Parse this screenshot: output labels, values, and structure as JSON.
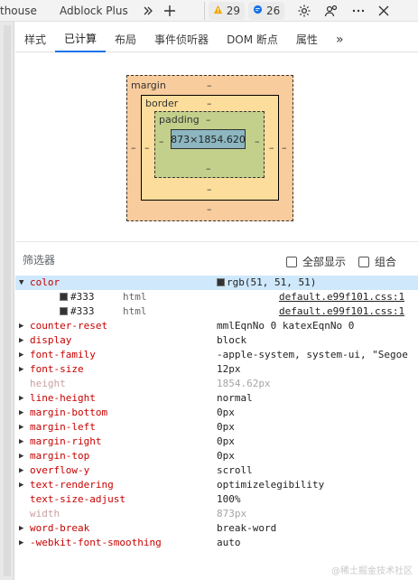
{
  "toolbar": {
    "tabs": [
      "thouse",
      "Adblock Plus"
    ],
    "more_icon": "chevrons-right-icon",
    "add_icon": "plus-icon",
    "warnings": "29",
    "messages": "26",
    "settings_icon": "gear-icon",
    "feedback_icon": "people-icon",
    "more_menu_icon": "ellipsis-icon",
    "close_icon": "close-icon"
  },
  "subtabs": [
    "样式",
    "已计算",
    "布局",
    "事件侦听器",
    "DOM 断点",
    "属性"
  ],
  "subtabs_more": "»",
  "boxmodel": {
    "margin_label": "margin",
    "border_label": "border",
    "padding_label": "padding",
    "content": "873×1854.620",
    "dash": "–"
  },
  "filter": {
    "label": "筛选器",
    "show_all": "全部显示",
    "group": "组合"
  },
  "properties": [
    {
      "name": "color",
      "value": "rgb(51, 51, 51)",
      "expanded": true,
      "swatch": true
    },
    {
      "name": "counter-reset",
      "value": "mmlEqnNo 0 katexEqnNo 0"
    },
    {
      "name": "display",
      "value": "block"
    },
    {
      "name": "font-family",
      "value": "-apple-system, system-ui, \"Segoe"
    },
    {
      "name": "font-size",
      "value": "12px"
    },
    {
      "name": "height",
      "value": "1854.62px",
      "inherited": true
    },
    {
      "name": "line-height",
      "value": "normal"
    },
    {
      "name": "margin-bottom",
      "value": "0px"
    },
    {
      "name": "margin-left",
      "value": "0px"
    },
    {
      "name": "margin-right",
      "value": "0px"
    },
    {
      "name": "margin-top",
      "value": "0px"
    },
    {
      "name": "overflow-y",
      "value": "scroll"
    },
    {
      "name": "text-rendering",
      "value": "optimizelegibility"
    },
    {
      "name": "text-size-adjust",
      "value": "100%",
      "no_arrow": true
    },
    {
      "name": "width",
      "value": "873px",
      "inherited": true
    },
    {
      "name": "word-break",
      "value": "break-word"
    },
    {
      "name": "-webkit-font-smoothing",
      "value": "auto"
    }
  ],
  "color_sources": [
    {
      "value": "#333",
      "selector": "html",
      "source": "default.e99f101.css:1"
    },
    {
      "value": "#333",
      "selector": "html",
      "source": "default.e99f101.css:1"
    }
  ],
  "watermark": "@稀土掘金技术社区"
}
